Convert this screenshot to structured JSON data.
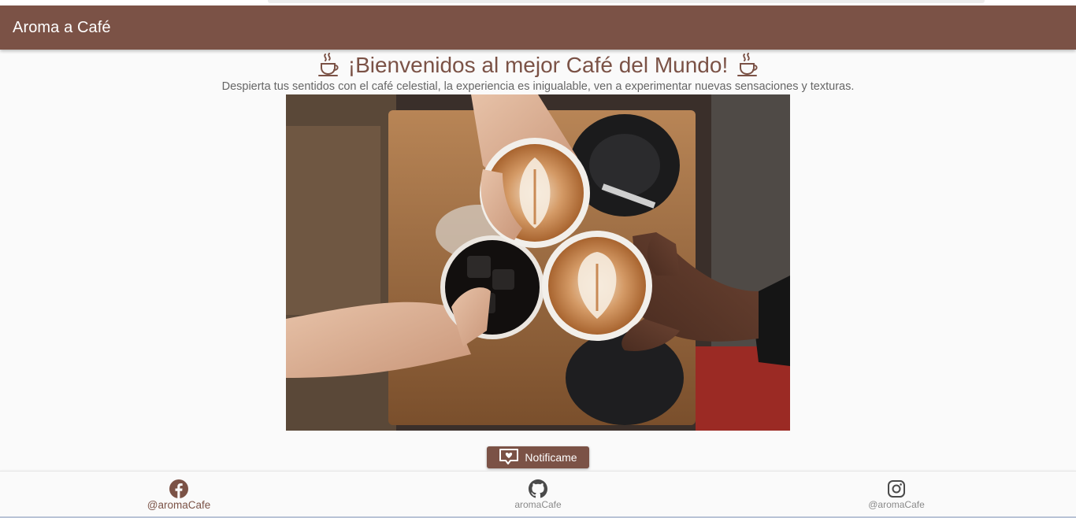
{
  "app": {
    "title": "Aroma a Café"
  },
  "hero": {
    "heading": "¡Bienvenidos al mejor Café del Mundo!",
    "subtitle": "Despierta tus sentidos con el café celestial, la experiencia es inigualable, ven a experimentar nuevas sensaciones y texturas.",
    "icon": "coffee-cup-icon",
    "image": "photo of three hands toasting with two latte-art cappuccinos and an iced coffee over a wooden table"
  },
  "actions": {
    "notify_label": "Notificame",
    "notify_icon": "heart-message-icon"
  },
  "footer": {
    "items": [
      {
        "icon": "facebook-icon",
        "label": "@aromaCafe"
      },
      {
        "icon": "github-icon",
        "label": "aromaCafe"
      },
      {
        "icon": "instagram-icon",
        "label": "@aromaCafe"
      }
    ]
  },
  "colors": {
    "brand": "#7b5246",
    "background": "#fafafa",
    "subtitle": "#666666"
  }
}
